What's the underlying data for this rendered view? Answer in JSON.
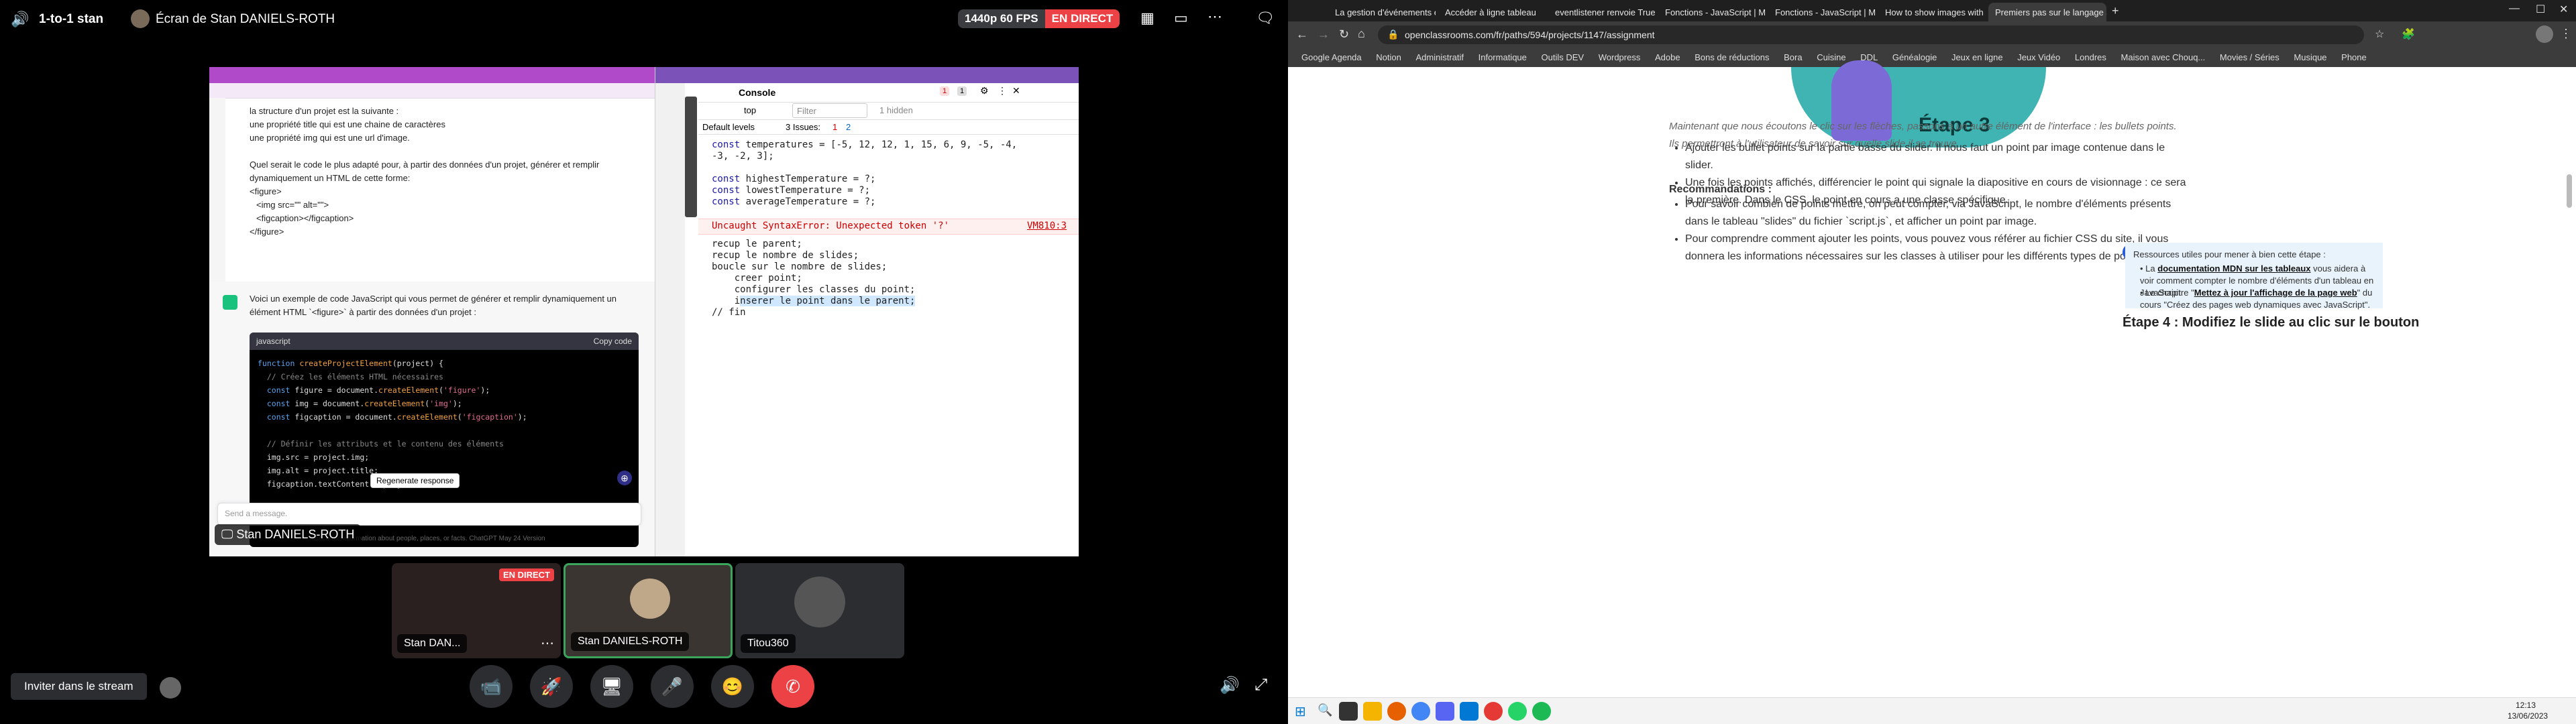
{
  "discord": {
    "channel": "1-to-1 stan",
    "screen_title": "Écran de Stan DANIELS-ROTH",
    "stream_quality": "1440p 60 FPS",
    "live_label": "EN DIRECT",
    "invite_button": "Inviter dans le stream",
    "presenter_tag": "Stan DANIELS-ROTH",
    "participants": [
      {
        "name": "Stan DAN...",
        "badge": "EN DIRECT"
      },
      {
        "name": "Stan DANIELS-ROTH"
      },
      {
        "name": "Titou360"
      }
    ]
  },
  "shared_screen": {
    "chat_lines": [
      "la structure d'un projet est la suivante :",
      "une propriété title qui est une chaine de caractères",
      "une propriété img qui est une url d'image.",
      "",
      "Quel serait le code le plus adapté pour, à partir des données d'un projet, générer et remplir",
      "dynamiquement un HTML de cette forme:",
      "<figure>",
      "  <img src=\"\" alt=\"\">",
      "  <figcaption></figcaption>",
      "</figure>"
    ],
    "answer_line1": "Voici un exemple de code JavaScript qui vous permet de générer et remplir dynamiquement un",
    "answer_line2": "élément HTML `<figure>` à partir des données d'un projet :",
    "code_lang": "javascript",
    "copy_label": "Copy code",
    "regenerate": "Regenerate response",
    "send_placeholder": "Send a message.",
    "footer_text": "inaccurate information about people, places, or facts. ChatGPT May 24 Version",
    "devtools": {
      "tab_console": "Console",
      "context": "top",
      "filter_placeholder": "Filter",
      "hidden": "1 hidden",
      "levels": "Default levels",
      "issues_label": "3 Issues:",
      "issues_err": "1",
      "issues_msg": "2",
      "err_count": "1",
      "warn_count": "1",
      "error_msg": "Uncaught SyntaxError: Unexpected token '?'",
      "error_src": "VM810:3"
    }
  },
  "browser": {
    "tabs": [
      "La gestion d'événements en Ja...",
      "Accéder à ligne tableau",
      "eventlistener renvoie True or fal...",
      "Fonctions - JavaScript | MDN",
      "Fonctions - JavaScript | MDN",
      "How to show images with a cli...",
      "Premiers pas sur le langage Ja..."
    ],
    "url": "openclassrooms.com/fr/paths/594/projects/1147/assignment",
    "bookmarks": [
      "Google Agenda",
      "Notion",
      "Administratif",
      "Informatique",
      "Outils DEV",
      "Wordpress",
      "Adobe",
      "Bons de réductions",
      "Bora",
      "Cuisine",
      "DDL",
      "Généalogie",
      "Jeux en ligne",
      "Jeux Vidéo",
      "Londres",
      "Maison avec Chouq...",
      "Movies / Séries",
      "Musique",
      "Phone"
    ],
    "hero_title": "Étape 3",
    "intro": "Maintenant que nous écoutons le clic sur les flèches, passons à un autre élément de l'interface : les bullets points. Ils permettront à l'utilisateur de savoir sur quelle slide il se trouve.",
    "bullets1": [
      "Ajouter les bullet points sur la partie basse du slider. Il nous faut un point par image contenue dans le slider.",
      "Une fois les points affichés, différencier le point qui signale la diapositive en cours de visionnage : ce sera la première. Dans le CSS, le point en cours a une classe spécifique."
    ],
    "reco_title": "Recommandations :",
    "bullets2": [
      "Pour savoir combien de points mettre, on peut compter, via JavaScript, le nombre d'éléments présents dans le tableau \"slides\" du fichier `script.js`, et afficher un point par image.",
      "Pour comprendre comment ajouter les points, vous pouvez vous référer au fichier CSS du site, il vous donnera les informations nécessaires sur les classes à utiliser pour les différents types de points."
    ],
    "resources_title": "Ressources utiles pour mener à bien cette étape :",
    "res1_pre": "La ",
    "res1_link": "documentation MDN sur les tableaux",
    "res1_post": " vous aidera à voir comment compter le nombre d'éléments d'un tableau en JavaScript.",
    "res2_pre": "Le chapitre \"",
    "res2_link": "Mettez à jour l'affichage de la page web",
    "res2_post": "\" du cours \"Créez des pages web dynamiques avec JavaScript\".",
    "step4": "Étape 4 : Modifiez le slide au clic sur le bouton",
    "clock_time": "12:13",
    "clock_date": "13/06/2023"
  },
  "colors": {
    "live_red": "#ed4245",
    "discord_bg": "#000000",
    "oc_purple": "#7451eb",
    "teal": "#2a9d9f"
  }
}
